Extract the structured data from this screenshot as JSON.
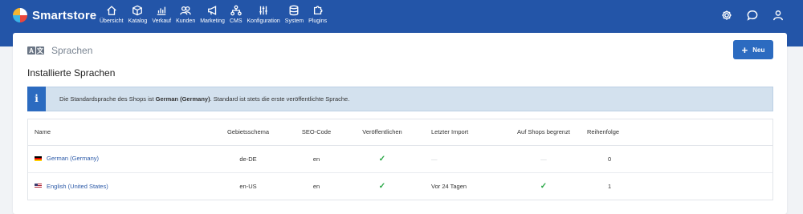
{
  "brand": {
    "name": "Smartstore"
  },
  "nav": [
    {
      "label": "Übersicht",
      "icon": "home-icon"
    },
    {
      "label": "Katalog",
      "icon": "box-icon"
    },
    {
      "label": "Verkauf",
      "icon": "chart-icon"
    },
    {
      "label": "Kunden",
      "icon": "users-icon"
    },
    {
      "label": "Marketing",
      "icon": "megaphone-icon"
    },
    {
      "label": "CMS",
      "icon": "sitemap-icon"
    },
    {
      "label": "Konfiguration",
      "icon": "sliders-icon"
    },
    {
      "label": "System",
      "icon": "database-icon"
    },
    {
      "label": "Plugins",
      "icon": "puzzle-icon"
    }
  ],
  "page": {
    "title": "Sprachen",
    "new_label": "Neu",
    "section_title": "Installierte Sprachen"
  },
  "alert": {
    "text_before": "Die Standardsprache des Shops ist ",
    "text_bold": "German (Germany)",
    "text_after": ". Standard ist stets die erste veröffentlichte Sprache."
  },
  "table": {
    "headers": {
      "name": "Name",
      "culture": "Gebietsschema",
      "seo": "SEO-Code",
      "published": "Veröffentlichen",
      "last_import": "Letzter Import",
      "limited": "Auf Shops begrenzt",
      "order": "Reihenfolge"
    },
    "rows": [
      {
        "name": "German (Germany)",
        "flag": "de",
        "culture": "de-DE",
        "seo": "en",
        "published": "✓",
        "last_import": "—",
        "limited": "—",
        "order": "0"
      },
      {
        "name": "English (United States)",
        "flag": "us",
        "culture": "en-US",
        "seo": "en",
        "published": "✓",
        "last_import": "Vor 24 Tagen",
        "limited": "✓",
        "order": "1"
      }
    ]
  },
  "colors": {
    "topbar": "#2355a8",
    "accent": "#2c6bc0",
    "check": "#28a745",
    "alert_bg": "#d3e1ee"
  }
}
